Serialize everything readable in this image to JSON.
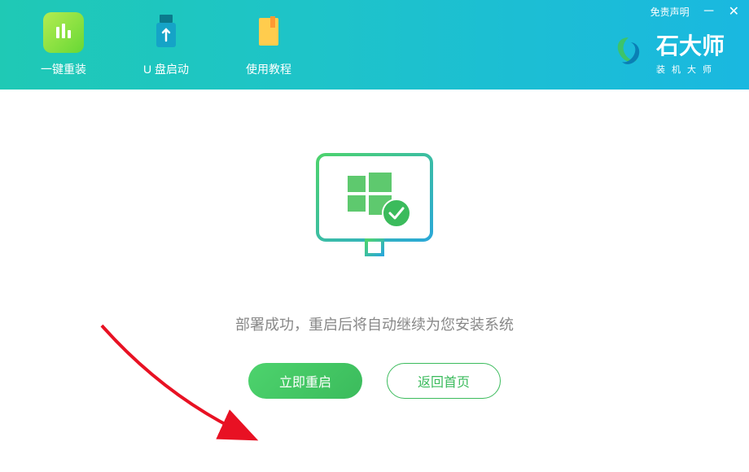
{
  "header": {
    "tabs": [
      {
        "label": "一键重装",
        "icon": "bars-icon"
      },
      {
        "label": "U 盘启动",
        "icon": "usb-icon"
      },
      {
        "label": "使用教程",
        "icon": "book-icon"
      }
    ],
    "brand": {
      "title": "石大师",
      "subtitle": "装机大师"
    },
    "disclaimer": "免责声明"
  },
  "main": {
    "status_text": "部署成功，重启后将自动继续为您安装系统",
    "restart_button": "立即重启",
    "home_button": "返回首页"
  }
}
